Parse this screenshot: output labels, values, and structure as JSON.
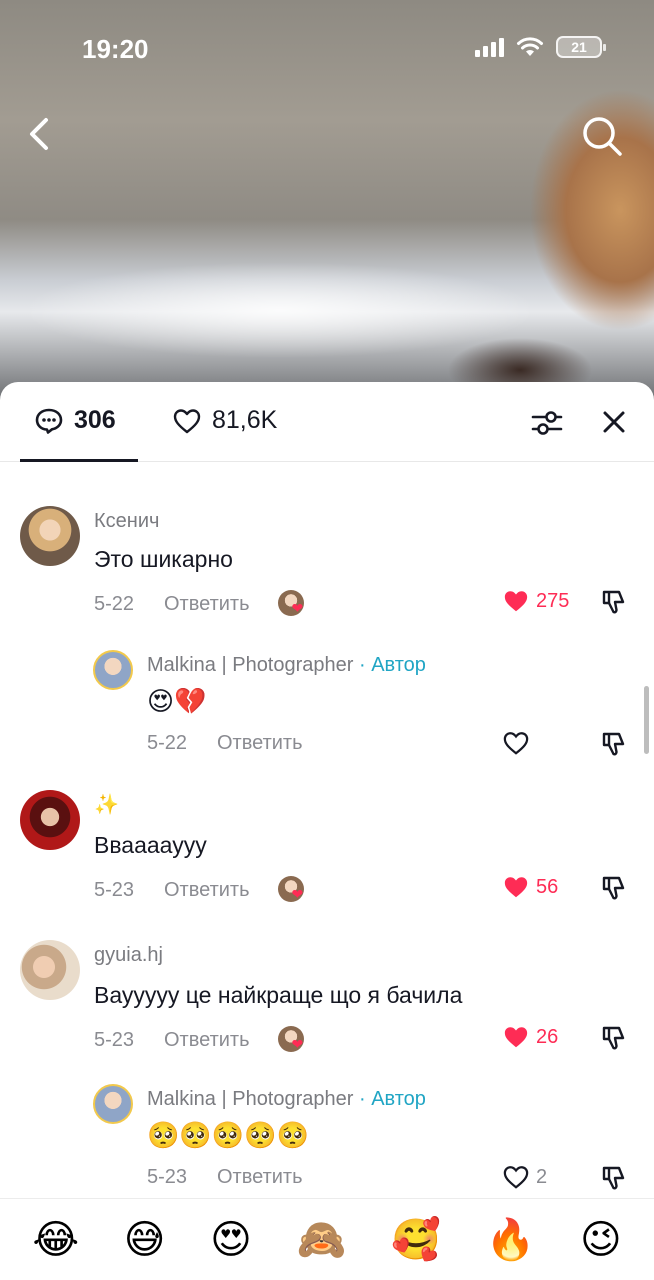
{
  "status_bar": {
    "time": "19:20",
    "battery": "21"
  },
  "tabs": {
    "comments_count": "306",
    "likes_count": "81,6K"
  },
  "comments": [
    {
      "user": "Ксенич",
      "text": "Это шикарно",
      "date": "5-22",
      "reply": "Ответить",
      "likes": "275",
      "liked": true
    },
    {
      "user": "Malkina | Photographer",
      "author_tag": "· Автор",
      "text": "😍💔",
      "date": "5-22",
      "reply": "Ответить",
      "likes": "",
      "liked": false
    },
    {
      "user": "✨",
      "text": "Вваааауyy",
      "date": "5-23",
      "reply": "Ответить",
      "likes": "56",
      "liked": true
    },
    {
      "user": "gyuia.hj",
      "text": "Вауyyyy це найкраще що я бачила",
      "date": "5-23",
      "reply": "Ответить",
      "likes": "26",
      "liked": true
    },
    {
      "user": "Malkina | Photographer",
      "author_tag": "· Автор",
      "text": "🥺🥺🥺🥺🥺",
      "date": "5-23",
      "reply": "Ответить",
      "likes": "2",
      "liked": false
    }
  ],
  "emoji_bar": [
    "😂",
    "😅",
    "😍",
    "🙈",
    "🥰",
    "🔥",
    "😉"
  ],
  "colors": {
    "like_red": "#fe2c55",
    "author_teal": "#20a5c4",
    "text_dark": "#161823",
    "meta_grey": "#8a8b91"
  }
}
